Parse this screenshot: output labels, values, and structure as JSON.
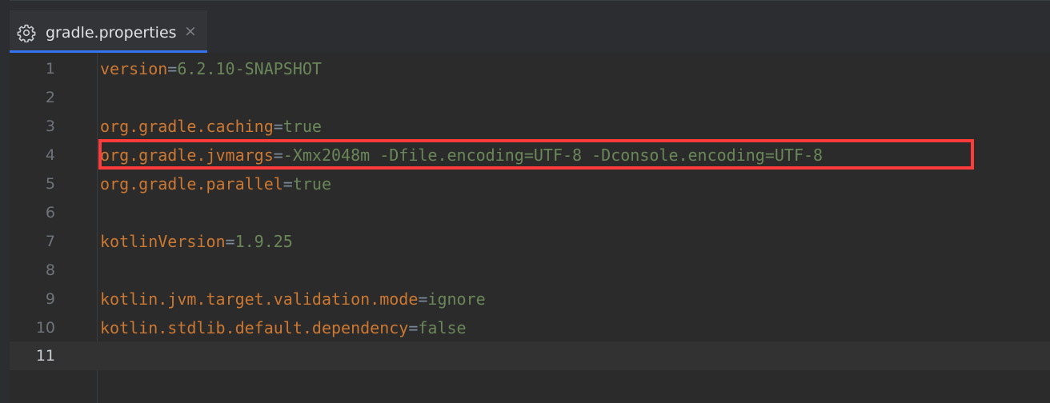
{
  "tab": {
    "filename": "gradle.properties",
    "icon": "gear-icon",
    "close_glyph": "×"
  },
  "lines": [
    {
      "number": "1",
      "key": "version",
      "sep": "=",
      "value": "6.2.10-SNAPSHOT"
    },
    {
      "number": "2",
      "key": "",
      "sep": "",
      "value": ""
    },
    {
      "number": "3",
      "key": "org.gradle.caching",
      "sep": "=",
      "value": "true"
    },
    {
      "number": "4",
      "key": "org.gradle.jvmargs",
      "sep": "=",
      "value": "-Xmx2048m -Dfile.encoding=UTF-8 -Dconsole.encoding=UTF-8"
    },
    {
      "number": "5",
      "key": "org.gradle.parallel",
      "sep": "=",
      "value": "true"
    },
    {
      "number": "6",
      "key": "",
      "sep": "",
      "value": ""
    },
    {
      "number": "7",
      "key": "kotlinVersion",
      "sep": "=",
      "value": "1.9.25"
    },
    {
      "number": "8",
      "key": "",
      "sep": "",
      "value": ""
    },
    {
      "number": "9",
      "key": "kotlin.jvm.target.validation.mode",
      "sep": "=",
      "value": "ignore"
    },
    {
      "number": "10",
      "key": "kotlin.stdlib.default.dependency",
      "sep": "=",
      "value": "false"
    },
    {
      "number": "11",
      "key": "",
      "sep": "",
      "value": ""
    }
  ],
  "current_line": "11",
  "highlighted_line": "4",
  "colors": {
    "key": "#cc7832",
    "value": "#6a8759",
    "highlight_box": "#ff3b3b",
    "tab_accent": "#3574f0"
  }
}
